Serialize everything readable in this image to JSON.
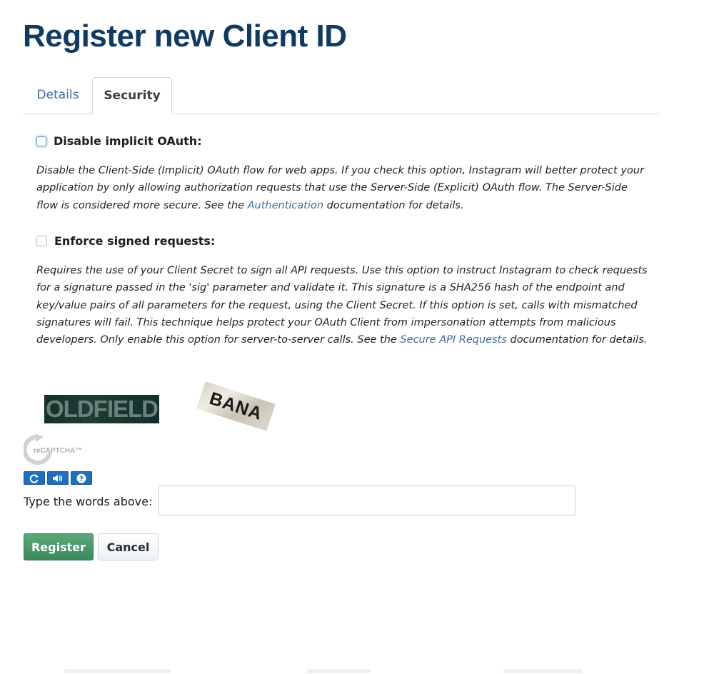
{
  "page": {
    "title": "Register new Client ID"
  },
  "tabs": [
    {
      "label": "Details",
      "active": false
    },
    {
      "label": "Security",
      "active": true
    }
  ],
  "options": [
    {
      "label": "Disable implicit OAuth:",
      "checked": false,
      "description_parts": [
        "Disable the Client-Side (Implicit) OAuth flow for web apps. If you check this option, Instagram will better protect your application by only allowing authorization requests that use the Server-Side (Explicit) OAuth flow. The Server-Side flow is considered more secure. See the ",
        "Authentication",
        " documentation for details."
      ]
    },
    {
      "label": "Enforce signed requests:",
      "checked": false,
      "description_parts": [
        "Requires the use of your Client Secret to sign all API requests. Use this option to instruct Instagram to check requests for a signature passed in the 'sig' parameter and validate it. This signature is a SHA256 hash of the endpoint and key/value pairs of all parameters for the request, using the Client Secret. If this option is set, calls with mismatched signatures will fail. This technique helps protect your OAuth Client from impersonation attempts from malicious developers. Only enable this option for server-to-server calls. See the ",
        "Secure API Requests",
        " documentation for details."
      ]
    }
  ],
  "captcha": {
    "words": [
      "OLDFIELD",
      "BANA"
    ],
    "logo_text": "reCAPTCHA™",
    "controls": [
      "refresh-icon",
      "audio-icon",
      "help-icon"
    ],
    "label": "Type the words above:",
    "input_value": ""
  },
  "actions": {
    "register_label": "Register",
    "cancel_label": "Cancel"
  },
  "colors": {
    "title": "#113a63",
    "link": "#3f6d9c",
    "register_button": "#4a9a6b",
    "captcha_control": "#1f6fbe"
  }
}
